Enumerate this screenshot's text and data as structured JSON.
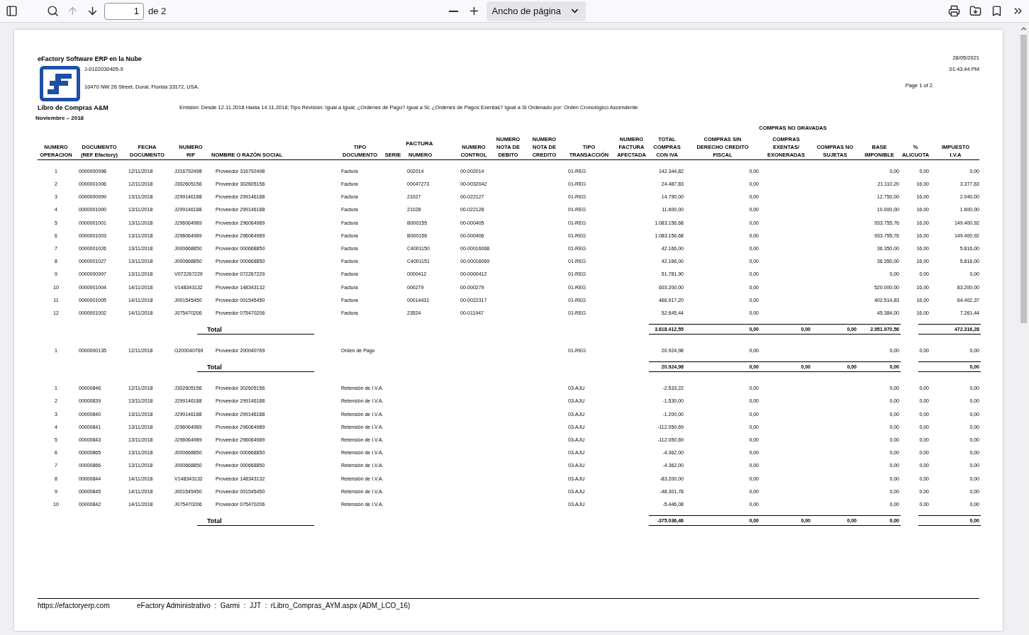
{
  "toolbar": {
    "left_buttons": [
      {
        "kind": "sidebar",
        "disabled": false
      },
      {
        "kind": "search",
        "disabled": false
      },
      {
        "kind": "previous",
        "disabled": true
      },
      {
        "kind": "next",
        "disabled": false
      }
    ],
    "page_input": "1",
    "page_count": "de 2",
    "zoom_buttons": [
      {
        "kind": "zoom_out"
      },
      {
        "kind": "zoom_in"
      }
    ],
    "zoom_select": "Ancho de página",
    "right_buttons": [
      {
        "kind": "print"
      },
      {
        "kind": "save"
      },
      {
        "kind": "bookmark"
      },
      {
        "kind": "more"
      }
    ]
  },
  "report": {
    "company": "eFactory Software ERP en la Nube",
    "rif": "J-0102030405-9",
    "address": "10470 NW 26 Street, Doral, Florida 33172, USA.",
    "date": "28/05/2021",
    "time": "01:43:44 PM",
    "page": "Page 1 of 2",
    "title": "Libro de Compras A&M",
    "filters": "Emisión: Desde 12.11.2018  Hasta 14.11.2018; Tipo Revisión: Igual a Igual; ¿Ordenes de Pago? Igual a Si; ¿Ordenes de Pagos Exentas? Igual a Si Ordenado por: Orden Cronológico Ascendente",
    "period": "Noviembre – 2018",
    "group_header": "COMPRAS NO GRAVADAS",
    "columns": [
      {
        "label": "NUMERO\nOPERACION"
      },
      {
        "label": "DOCUMENTO\n(REF Efactory)"
      },
      {
        "label": "FECHA\nDOCUMENTO"
      },
      {
        "label": "NUMERO\nRIF"
      },
      {
        "label": "NOMBRE O RAZÓN SOCIAL"
      },
      {
        "label": "TIPO\nDOCUMENTO"
      },
      {
        "label": "FACTURA",
        "children": [
          {
            "label": "SERIE"
          },
          {
            "label": "NUMERO"
          }
        ]
      },
      {
        "label": "NUMERO\nCONTROL"
      },
      {
        "label": "NUMERO\nNOTA DE\nDEBITO"
      },
      {
        "label": "NUMERO\nNOTA DE\nCREDITO"
      },
      {
        "label": "TIPO\nTRANSACCIÓN"
      },
      {
        "label": "NUMERO\nFACTURA\nAFECTADA"
      },
      {
        "label": "TOTAL\nCOMPRAS\nCON IVA"
      },
      {
        "label": "COMPRAS SIN\nDERECHO CREDITO\nFISCAL"
      },
      {
        "label": "COMPRAS\nEXENTAS/\nEXONERADAS"
      },
      {
        "label": "COMPRAS NO\nSUJETAS"
      },
      {
        "label": "BASE\nIMPONIBLE"
      },
      {
        "label": "%\nALICUOTA"
      },
      {
        "label": "IMPUESTO\nI.V.A"
      }
    ],
    "sections": [
      {
        "rows": [
          {
            "numero": "1",
            "documento": "0000000998",
            "fecha": "12/11/2018",
            "rif": "J316792498",
            "nombre": "Proveedor 316792498",
            "tipo_documento": "Factura",
            "factura_numero": "002014",
            "numero_control": "00-002014",
            "tipo_transaccion": "01-REG",
            "total_compras": "142.344,82",
            "sin_derecho": "0,00",
            "base_imponible": "0,00",
            "alicuota": "0,00",
            "impuesto": "0,00"
          },
          {
            "numero": "2",
            "documento": "0000001006",
            "fecha": "12/11/2018",
            "rif": "J302605156",
            "nombre": "Proveedor 302605156",
            "tipo_documento": "Factura",
            "factura_numero": "00047273",
            "numero_control": "00-0032042",
            "tipo_transaccion": "01-REG",
            "total_compras": "24.487,83",
            "sin_derecho": "0,00",
            "base_imponible": "21.110,20",
            "alicuota": "16,00",
            "impuesto": "3.377,63"
          },
          {
            "numero": "3",
            "documento": "0000000999",
            "fecha": "13/11/2018",
            "rif": "J299146188",
            "nombre": "Proveedor 299146188",
            "tipo_documento": "Factura",
            "factura_numero": "21027",
            "numero_control": "00-022127",
            "tipo_transaccion": "01-REG",
            "total_compras": "14.790,00",
            "sin_derecho": "0,00",
            "base_imponible": "12.750,00",
            "alicuota": "16,00",
            "impuesto": "2.040,00"
          },
          {
            "numero": "4",
            "documento": "0000001000",
            "fecha": "13/11/2018",
            "rif": "J299146188",
            "nombre": "Proveedor 299146188",
            "tipo_documento": "Factura",
            "factura_numero": "21028",
            "numero_control": "00-022128",
            "tipo_transaccion": "01-REG",
            "total_compras": "11.600,00",
            "sin_derecho": "0,00",
            "base_imponible": "10.000,00",
            "alicuota": "16,00",
            "impuesto": "1.600,00"
          },
          {
            "numero": "5",
            "documento": "0000001001",
            "fecha": "13/11/2018",
            "rif": "J296064989",
            "nombre": "Proveedor 296064989",
            "tipo_documento": "Factura",
            "factura_numero": "B000155",
            "numero_control": "00-000405",
            "tipo_transaccion": "01-REG",
            "total_compras": "1.083.156,68",
            "sin_derecho": "0,00",
            "base_imponible": "933.755,76",
            "alicuota": "16,00",
            "impuesto": "149.400,92"
          },
          {
            "numero": "6",
            "documento": "0000001003",
            "fecha": "13/11/2018",
            "rif": "J296064989",
            "nombre": "Proveedor 296064989",
            "tipo_documento": "Factura",
            "factura_numero": "B000156",
            "numero_control": "00-000406",
            "tipo_transaccion": "01-REG",
            "total_compras": "1.083.156,68",
            "sin_derecho": "0,00",
            "base_imponible": "933.755,76",
            "alicuota": "16,00",
            "impuesto": "149.400,92"
          },
          {
            "numero": "7",
            "documento": "0000001026",
            "fecha": "13/11/2018",
            "rif": "J000668850",
            "nombre": "Proveedor 000668850",
            "tipo_documento": "Factura",
            "factura_numero": "C4001150",
            "numero_control": "00-00016068",
            "tipo_transaccion": "01-REG",
            "total_compras": "42.166,00",
            "sin_derecho": "0,00",
            "base_imponible": "36.350,00",
            "alicuota": "16,00",
            "impuesto": "5.816,00"
          },
          {
            "numero": "8",
            "documento": "0000001027",
            "fecha": "13/11/2018",
            "rif": "J000668850",
            "nombre": "Proveedor 000668850",
            "tipo_documento": "Factura",
            "factura_numero": "C4001151",
            "numero_control": "00-00016069",
            "tipo_transaccion": "01-REG",
            "total_compras": "42.166,00",
            "sin_derecho": "0,00",
            "base_imponible": "36.350,00",
            "alicuota": "16,00",
            "impuesto": "5.816,00"
          },
          {
            "numero": "9",
            "documento": "0000000997",
            "fecha": "13/11/2018",
            "rif": "V072267229",
            "nombre": "Proveedor 072267229",
            "tipo_documento": "Factura",
            "factura_numero": "0000412",
            "numero_control": "00-0000412",
            "tipo_transaccion": "01-REG",
            "total_compras": "51.781,90",
            "sin_derecho": "0,00",
            "base_imponible": "0,00",
            "alicuota": "0,00",
            "impuesto": "0,00"
          },
          {
            "numero": "10",
            "documento": "0000001004",
            "fecha": "14/11/2018",
            "rif": "V148343132",
            "nombre": "Proveedor 148343132",
            "tipo_documento": "Factura",
            "factura_numero": "000279",
            "numero_control": "00-000279",
            "tipo_transaccion": "01-REG",
            "total_compras": "603.200,00",
            "sin_derecho": "0,00",
            "base_imponible": "520.000,00",
            "alicuota": "16,00",
            "impuesto": "83.200,00"
          },
          {
            "numero": "11",
            "documento": "0000001005",
            "fecha": "14/11/2018",
            "rif": "J001545450",
            "nombre": "Proveedor 001545450",
            "tipo_documento": "Factura",
            "factura_numero": "00014431",
            "numero_control": "00-0022317",
            "tipo_transaccion": "01-REG",
            "total_compras": "466.917,20",
            "sin_derecho": "0,00",
            "base_imponible": "402.514,83",
            "alicuota": "16,00",
            "impuesto": "64.402,37"
          },
          {
            "numero": "12",
            "documento": "0000001002",
            "fecha": "14/11/2018",
            "rif": "J075470206",
            "nombre": "Proveedor 075470206",
            "tipo_documento": "Factura",
            "factura_numero": "23524",
            "numero_control": "00-011947",
            "tipo_transaccion": "01-REG",
            "total_compras": "52.645,44",
            "sin_derecho": "0,00",
            "base_imponible": "45.384,00",
            "alicuota": "16,00",
            "impuesto": "7.261,44"
          }
        ],
        "total": {
          "label": "Total",
          "total_compras": "3.618.412,55",
          "sin_derecho": "0,00",
          "exentas": "0,00",
          "no_sujetas": "0,00",
          "base_imponible": "2.951.970,56",
          "impuesto": "472.316,28"
        }
      },
      {
        "rows": [
          {
            "numero": "1",
            "documento": "0000000135",
            "fecha": "12/11/2018",
            "rif": "G200040769",
            "nombre": "Proveedor 200040769",
            "tipo_documento": "Orden de Pago",
            "tipo_transaccion": "01-REG",
            "total_compras": "20.924,98",
            "sin_derecho": "0,00",
            "base_imponible": "0,00",
            "alicuota": "0,00",
            "impuesto": "0,00"
          }
        ],
        "total": {
          "label": "Total",
          "total_compras": "20.924,98",
          "sin_derecho": "0,00",
          "exentas": "0,00",
          "no_sujetas": "0,00",
          "base_imponible": "0,00",
          "impuesto": "0,00"
        }
      },
      {
        "rows": [
          {
            "numero": "1",
            "documento": "00000846",
            "fecha": "12/11/2018",
            "rif": "J302605156",
            "nombre": "Proveedor 302605156",
            "tipo_documento": "Retensión de I.V.A.",
            "tipo_transaccion": "03-AJU",
            "total_compras": "-2.533,22",
            "sin_derecho": "0,00",
            "base_imponible": "0,00",
            "alicuota": "0,00",
            "impuesto": "0,00"
          },
          {
            "numero": "2",
            "documento": "00000839",
            "fecha": "13/11/2018",
            "rif": "J299146188",
            "nombre": "Proveedor 299146188",
            "tipo_documento": "Retensión de I.V.A.",
            "tipo_transaccion": "03-AJU",
            "total_compras": "-1.530,00",
            "sin_derecho": "0,00",
            "base_imponible": "0,00",
            "alicuota": "0,00",
            "impuesto": "0,00"
          },
          {
            "numero": "3",
            "documento": "00000840",
            "fecha": "13/11/2018",
            "rif": "J299146188",
            "nombre": "Proveedor 299146188",
            "tipo_documento": "Retensión de I.V.A.",
            "tipo_transaccion": "03-AJU",
            "total_compras": "-1.200,00",
            "sin_derecho": "0,00",
            "base_imponible": "0,00",
            "alicuota": "0,00",
            "impuesto": "0,00"
          },
          {
            "numero": "4",
            "documento": "00000841",
            "fecha": "13/11/2018",
            "rif": "J296064989",
            "nombre": "Proveedor 296064989",
            "tipo_documento": "Retensión de I.V.A.",
            "tipo_transaccion": "03-AJU",
            "total_compras": "-112.050,69",
            "sin_derecho": "0,00",
            "base_imponible": "0,00",
            "alicuota": "0,00",
            "impuesto": "0,00"
          },
          {
            "numero": "5",
            "documento": "00000843",
            "fecha": "13/11/2018",
            "rif": "J296064989",
            "nombre": "Proveedor 296064989",
            "tipo_documento": "Retensión de I.V.A.",
            "tipo_transaccion": "03-AJU",
            "total_compras": "-112.050,69",
            "sin_derecho": "0,00",
            "base_imponible": "0,00",
            "alicuota": "0,00",
            "impuesto": "0,00"
          },
          {
            "numero": "6",
            "documento": "00000865",
            "fecha": "13/11/2018",
            "rif": "J000668850",
            "nombre": "Proveedor 000668850",
            "tipo_documento": "Retensión de I.V.A.",
            "tipo_transaccion": "03-AJU",
            "total_compras": "-4.362,00",
            "sin_derecho": "0,00",
            "base_imponible": "0,00",
            "alicuota": "0,00",
            "impuesto": "0,00"
          },
          {
            "numero": "7",
            "documento": "00000866",
            "fecha": "13/11/2018",
            "rif": "J000668850",
            "nombre": "Proveedor 000668850",
            "tipo_documento": "Retensión de I.V.A.",
            "tipo_transaccion": "03-AJU",
            "total_compras": "-4.362,00",
            "sin_derecho": "0,00",
            "base_imponible": "0,00",
            "alicuota": "0,00",
            "impuesto": "0,00"
          },
          {
            "numero": "8",
            "documento": "00000844",
            "fecha": "14/11/2018",
            "rif": "V148343132",
            "nombre": "Proveedor 148343132",
            "tipo_documento": "Retensión de I.V.A.",
            "tipo_transaccion": "03-AJU",
            "total_compras": "-83.200,00",
            "sin_derecho": "0,00",
            "base_imponible": "0,00",
            "alicuota": "0,00",
            "impuesto": "0,00"
          },
          {
            "numero": "9",
            "documento": "00000845",
            "fecha": "14/11/2018",
            "rif": "J001545450",
            "nombre": "Proveedor 001545450",
            "tipo_documento": "Retensión de I.V.A.",
            "tipo_transaccion": "03-AJU",
            "total_compras": "-48.301,78",
            "sin_derecho": "0,00",
            "base_imponible": "0,00",
            "alicuota": "0,00",
            "impuesto": "0,00"
          },
          {
            "numero": "10",
            "documento": "00000842",
            "fecha": "14/11/2018",
            "rif": "J075470206",
            "nombre": "Proveedor 075470206",
            "tipo_documento": "Retensión de I.V.A.",
            "tipo_transaccion": "03-AJU",
            "total_compras": "-5.446,08",
            "sin_derecho": "0,00",
            "base_imponible": "0,00",
            "alicuota": "0,00",
            "impuesto": "0,00"
          }
        ],
        "total": {
          "label": "Total",
          "total_compras": "-375.036,46",
          "sin_derecho": "0,00",
          "exentas": "0,00",
          "no_sujetas": "0,00",
          "base_imponible": "0,00",
          "impuesto": "0,00"
        }
      }
    ],
    "footer": {
      "url": "https://efactoryerp.com",
      "info": "eFactory Administrativo  :  Garmi  :  JJT  :  rLibro_Compras_AYM.aspx (ADM_LCO_16)"
    }
  }
}
